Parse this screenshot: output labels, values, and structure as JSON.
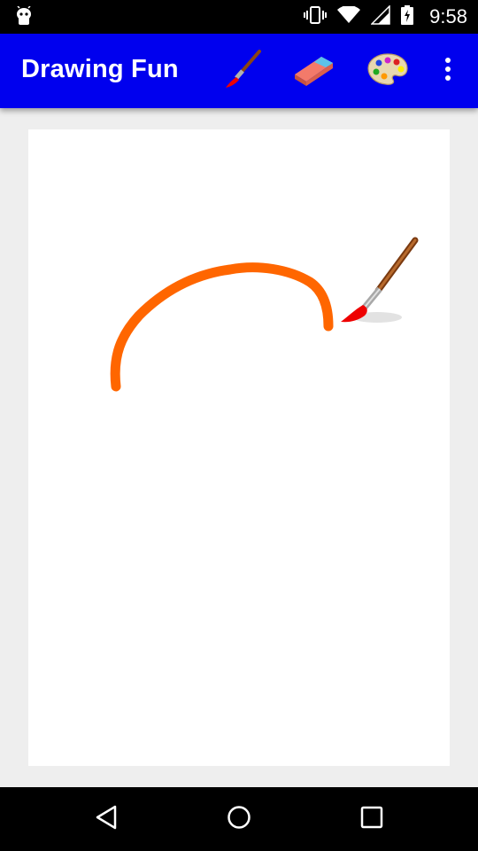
{
  "status_bar": {
    "time": "9:58",
    "icons": [
      "android-notification-icon",
      "vibrate-icon",
      "wifi-icon",
      "signal-icon",
      "battery-charging-icon"
    ]
  },
  "app_bar": {
    "title": "Drawing Fun",
    "actions": [
      "paintbrush-icon",
      "eraser-icon",
      "palette-icon",
      "overflow-menu-icon"
    ],
    "bar_color": "#0000ee"
  },
  "canvas": {
    "stroke_color": "#ff6600",
    "cursor": "paintbrush-cursor-icon"
  },
  "nav_bar": {
    "buttons": [
      "back-icon",
      "home-icon",
      "recents-icon"
    ]
  }
}
